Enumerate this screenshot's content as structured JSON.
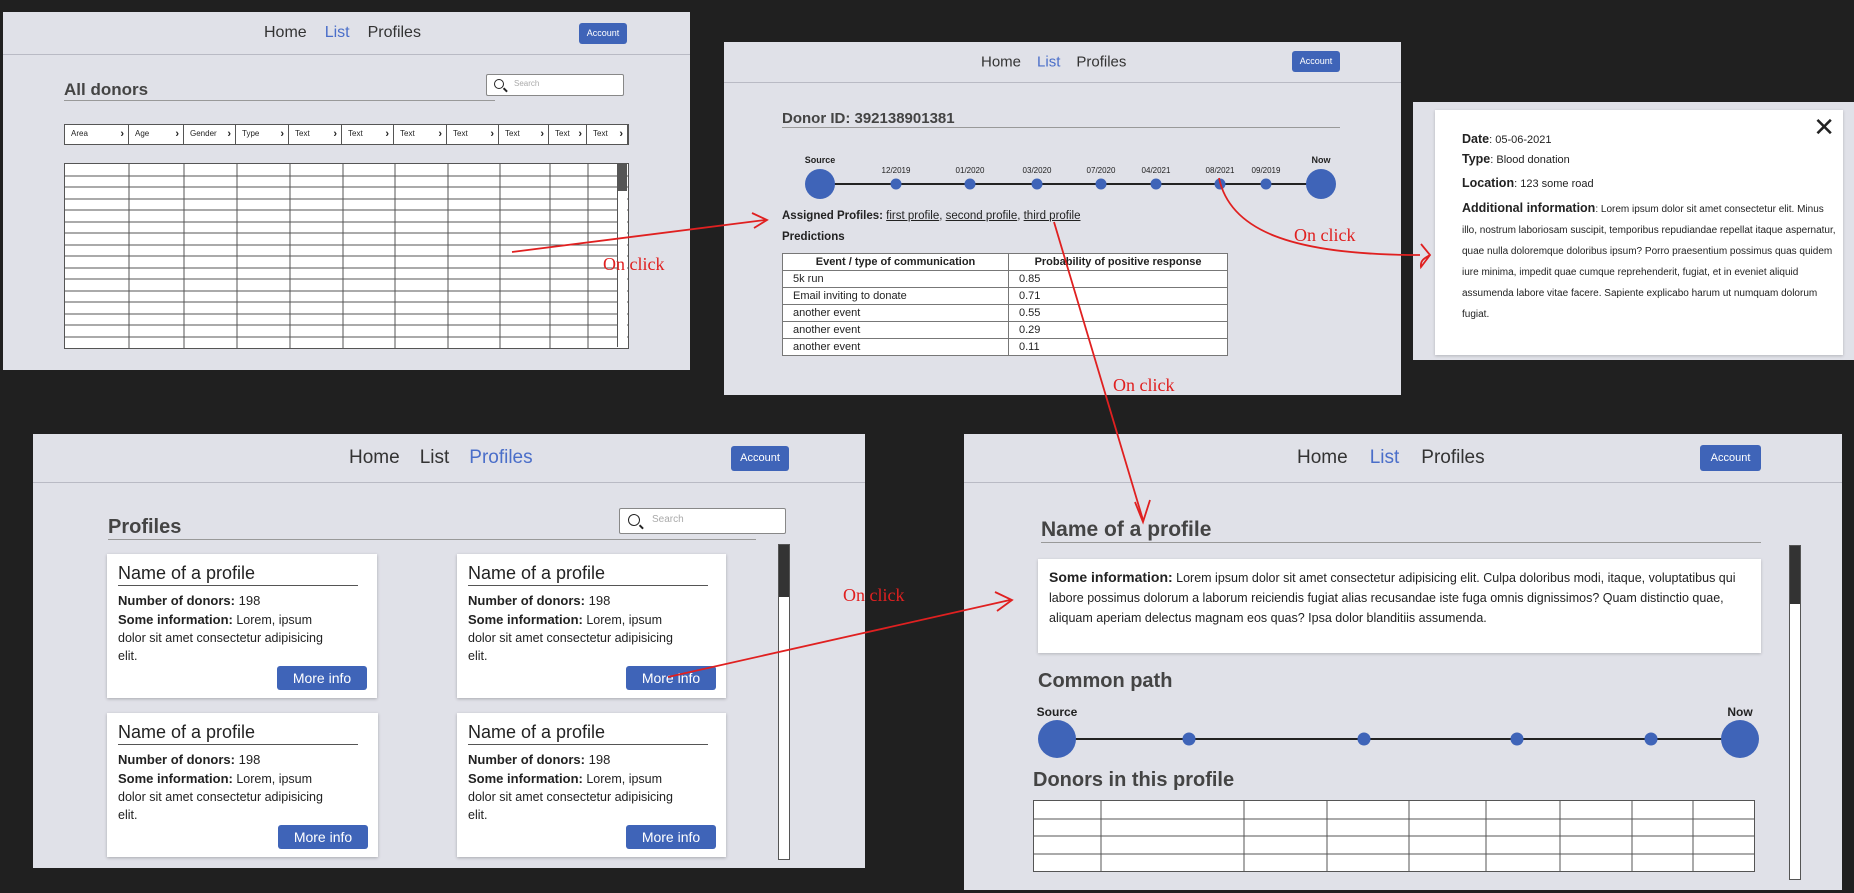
{
  "nav": {
    "home": "Home",
    "list": "List",
    "profiles": "Profiles",
    "account": "Account"
  },
  "list_page": {
    "title": "All donors",
    "search_placeholder": "Search",
    "columns": [
      "Area",
      "Age",
      "Gender",
      "Type",
      "Text",
      "Text",
      "Text",
      "Text",
      "Text",
      "Text",
      "Text"
    ]
  },
  "donor_page": {
    "donor_id": "Donor ID: 392138901381",
    "timeline": [
      "Source",
      "12/2019",
      "01/2020",
      "03/2020",
      "07/2020",
      "04/2021",
      "08/2021",
      "09/2019",
      "Now"
    ],
    "assigned_label": "Assigned Profiles:",
    "assigned_links": [
      "first profile",
      "second profile",
      "third profile"
    ],
    "predictions_label": "Predictions",
    "table_headers": [
      "Event / type of communication",
      "Probability of positive response"
    ],
    "table_rows": [
      [
        "5k run",
        "0.85"
      ],
      [
        "Email inviting to donate",
        "0.71"
      ],
      [
        "another event",
        "0.55"
      ],
      [
        "another event",
        "0.29"
      ],
      [
        "another event",
        "0.11"
      ]
    ]
  },
  "event_popup": {
    "date_label": "Date",
    "date_value": ": 05-06-2021",
    "type_label": "Type",
    "type_value": ": Blood donation",
    "location_label": "Location",
    "location_value": ": 123 some road",
    "info_label": "Additional information",
    "info_value": ": Lorem ipsum dolor sit amet consectetur elit. Minus illo, nostrum laboriosam suscipit, temporibus repudiandae repellat itaque aspernatur, quae nulla doloremque doloribus ipsum? Porro praesentium possimus quas quidem iure minima, impedit quae cumque reprehenderit, fugiat, et in eveniet aliquid assumenda labore vitae facere. Sapiente explicabo harum ut numquam dolorum fugiat.",
    "close_icon": "close-icon"
  },
  "profiles_page": {
    "title": "Profiles",
    "search_placeholder": "Search",
    "cards": [
      {
        "name": "Name of a profile",
        "donors_label": "Number of donors:",
        "donors": "198",
        "info_label": "Some information:",
        "info": "Lorem, ipsum dolor sit amet consectetur adipisicing elit.",
        "button": "More info"
      },
      {
        "name": "Name of a profile",
        "donors_label": "Number of donors:",
        "donors": "198",
        "info_label": "Some information:",
        "info": "Lorem, ipsum dolor sit amet consectetur adipisicing elit.",
        "button": "More info"
      },
      {
        "name": "Name of a profile",
        "donors_label": "Number of donors:",
        "donors": "198",
        "info_label": "Some information:",
        "info": "Lorem, ipsum dolor sit amet consectetur adipisicing elit.",
        "button": "More info"
      },
      {
        "name": "Name of a profile",
        "donors_label": "Number of donors:",
        "donors": "198",
        "info_label": "Some information:",
        "info": "Lorem, ipsum dolor sit amet consectetur adipisicing elit.",
        "button": "More info"
      }
    ]
  },
  "profile_detail": {
    "title": "Name of a profile",
    "info_label": "Some information:",
    "info": "Lorem ipsum dolor sit amet consectetur adipisicing elit. Culpa doloribus modi, itaque, voluptatibus qui labore possimus dolorum a laborum reiciendis fugiat alias recusandae iste fuga omnis dignissimos? Quam distinctio quae, aliquam aperiam delectus magnam eos quas? Ipsa dolor blanditiis assumenda.",
    "common_path": "Common path",
    "source": "Source",
    "now": "Now",
    "donors_title": "Donors in this profile"
  },
  "annotations": {
    "on_click": "On click"
  },
  "colors": {
    "accent": "#3f64b8",
    "link_active": "#4a6ec9",
    "annotation": "#e02020",
    "frame_bg": "#e0e1e8"
  }
}
